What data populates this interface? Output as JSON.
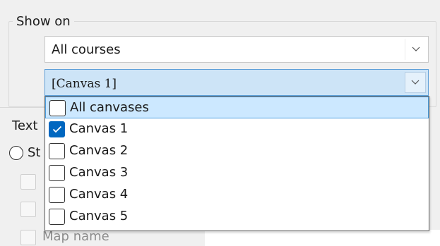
{
  "show_on": {
    "title": "Show on",
    "course_select": {
      "value": "All courses",
      "arrow_icon": "chevron-down-icon"
    },
    "canvas_select": {
      "value": "[Canvas 1]",
      "arrow_icon": "chevron-down-icon",
      "expanded": true,
      "items": [
        {
          "label": "All canvases",
          "checked": false,
          "highlighted": true
        },
        {
          "label": "Canvas 1",
          "checked": true,
          "highlighted": false
        },
        {
          "label": "Canvas 2",
          "checked": false,
          "highlighted": false
        },
        {
          "label": "Canvas 3",
          "checked": false,
          "highlighted": false
        },
        {
          "label": "Canvas 4",
          "checked": false,
          "highlighted": false
        },
        {
          "label": "Canvas 5",
          "checked": false,
          "highlighted": false
        }
      ]
    }
  },
  "text_section": {
    "title_partial": "Text",
    "radio_label_partial": "St",
    "checkbox_label": "Map name"
  },
  "colors": {
    "window_bg": "#f0f0f0",
    "selection_bg": "#cce8ff",
    "selection_border": "#4d9fe0",
    "check_accent": "#0067c0"
  }
}
